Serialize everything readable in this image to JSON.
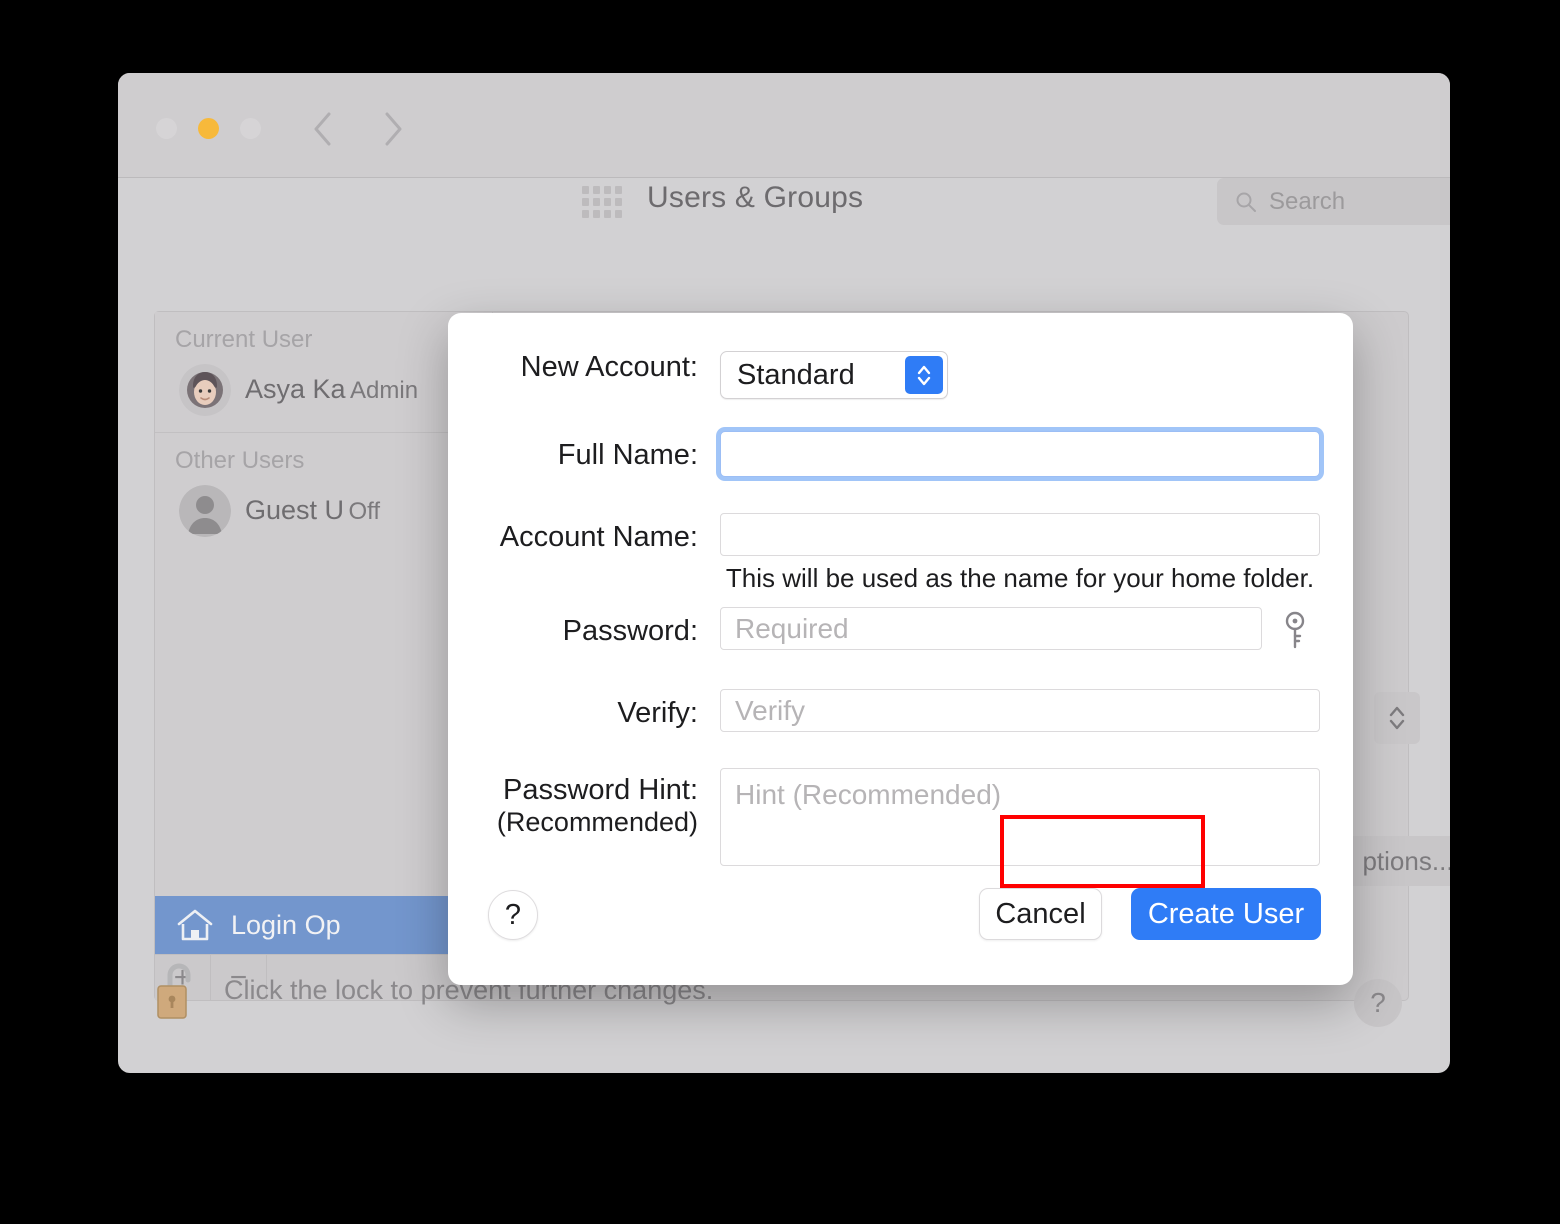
{
  "window": {
    "title": "Users & Groups",
    "traffic_lights": [
      "close-button",
      "minimize-button",
      "zoom-button"
    ],
    "nav": {
      "back": "back-chevron",
      "forward": "forward-chevron",
      "show_all": "grid-icon"
    },
    "search": {
      "placeholder": "Search",
      "value": "",
      "icon": "search-icon"
    }
  },
  "sidebar": {
    "groups": [
      {
        "header": "Current User",
        "users": [
          {
            "name": "Asya Ka",
            "role": "Admin",
            "avatar": "user-photo-avatar"
          }
        ]
      },
      {
        "header": "Other Users",
        "users": [
          {
            "name": "Guest U",
            "role": "Off",
            "avatar": "generic-person-avatar"
          }
        ]
      }
    ],
    "login_options": {
      "label": "Login Op",
      "icon": "house-icon",
      "selected": true
    },
    "add_button": "+",
    "remove_button": "−"
  },
  "right_pane": {
    "options_button": "ptions...",
    "stepper": "stepper-control"
  },
  "footer": {
    "lock_icon": "unlocked-padlock-icon",
    "lock_text": "Click the lock to prevent further changes.",
    "help_button": "?"
  },
  "dialog": {
    "fields": {
      "new_account": {
        "label": "New Account:",
        "value": "Standard",
        "options": [
          "Standard"
        ]
      },
      "full_name": {
        "label": "Full Name:",
        "value": "",
        "placeholder": "",
        "focused": true
      },
      "account_name": {
        "label": "Account Name:",
        "value": "",
        "placeholder": "",
        "note": "This will be used as the name for your home folder."
      },
      "password": {
        "label": "Password:",
        "value": "",
        "placeholder": "Required",
        "key_icon": "key-icon"
      },
      "verify": {
        "label": "Verify:",
        "value": "",
        "placeholder": "Verify"
      },
      "password_hint": {
        "label": "Password Hint:",
        "label_sub": "(Recommended)",
        "value": "",
        "placeholder": "Hint (Recommended)"
      }
    },
    "buttons": {
      "help": "?",
      "cancel": "Cancel",
      "create": "Create User"
    }
  },
  "annotation": {
    "shape": "rectangle",
    "color": "#ff0000",
    "target": "Create User"
  },
  "colors": {
    "accent_blue": "#2f7cf6",
    "focus_ring": "#5496f3",
    "window_bg": "#d2d1d3",
    "titlebar": "#cfcdcf",
    "selection_blue": "#7396cd",
    "annotation_red": "#ff0000",
    "yellow_light": "#f7b93b"
  }
}
